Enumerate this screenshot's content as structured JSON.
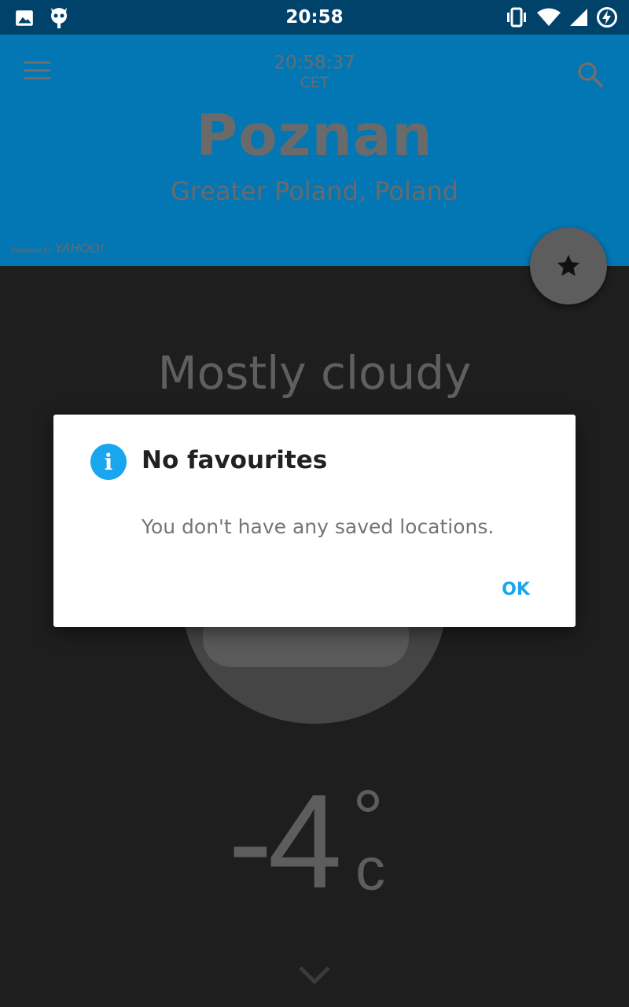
{
  "status_bar": {
    "time": "20:58",
    "left_icons": [
      "image-icon",
      "android-debug-icon"
    ],
    "right_icons": [
      "vibrate-icon",
      "wifi-icon",
      "cell-signal-icon",
      "battery-charging-icon"
    ]
  },
  "header": {
    "clock": "20:58:37",
    "timezone": "CET",
    "city": "Poznan",
    "region": "Greater Poland, Poland",
    "powered_by": "Powered by",
    "powered_brand": "YAHOO!",
    "menu_icon": "menu-icon",
    "search_icon": "search-icon",
    "favourite_icon": "star-icon",
    "background_color": "#0277b4"
  },
  "weather": {
    "condition": "Mostly cloudy",
    "temperature": "-4",
    "degree_symbol": "°",
    "unit": "c",
    "expand_icon": "chevron-down-icon"
  },
  "dialog": {
    "title": "No favourites",
    "message": "You don't have any saved locations.",
    "ok_label": "OK",
    "info_glyph": "i",
    "accent_color": "#1aa5ef"
  }
}
